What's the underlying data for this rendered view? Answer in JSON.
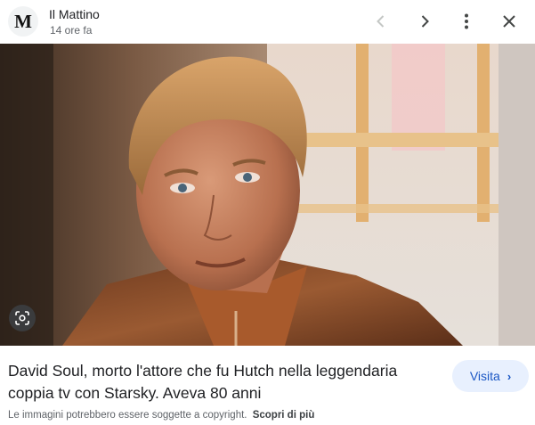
{
  "header": {
    "logo_letter": "M",
    "source_name": "Il Mattino",
    "timestamp": "14 ore fa"
  },
  "icons": {
    "prev": "chevron-left-icon",
    "next": "chevron-right-icon",
    "more": "more-vert-icon",
    "close": "close-icon",
    "lens": "google-lens-icon"
  },
  "article": {
    "title": "David Soul, morto l'attore che fu Hutch nella leggendaria coppia tv con Starsky. Aveva 80 anni",
    "visit_label": "Visita",
    "visit_chevron": "›"
  },
  "footer": {
    "copyright_note": "Le immagini potrebbero essere soggette a copyright.",
    "learn_more": "Scopri di più"
  },
  "colors": {
    "visit_bg": "#e8f0fe",
    "visit_text": "#1a56c4",
    "disabled_icon": "#c4c7c5",
    "icon": "#444746"
  }
}
